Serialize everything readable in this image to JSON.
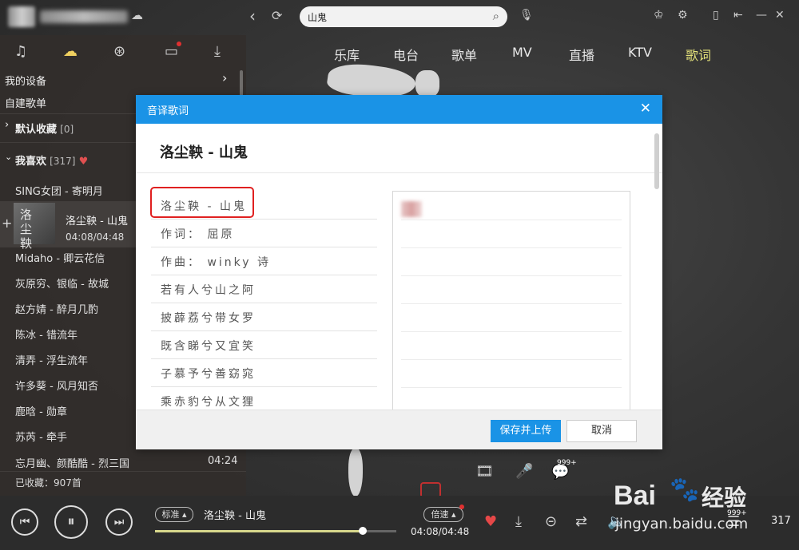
{
  "search": {
    "value": "山鬼"
  },
  "sidebar": {
    "my_devices": "我的设备",
    "custom_playlists": "自建歌单",
    "default_fav_label": "默认收藏",
    "default_fav_count": "[0]",
    "my_likes_label": "我喜欢",
    "my_likes_count": "[317]",
    "songs": [
      "SING女团 - 寄明月",
      "Midaho - 卿云花信",
      "灰原穷、银临 - 故城",
      "赵方婧 - 醉月几酌",
      "陈冰 - 错流年",
      "清弄 - 浮生流年",
      "许多葵 - 风月知否",
      "鹿晗 - 勋章",
      "苏芮 - 牵手",
      "忘月幽、颜酷酷 - 烈三国"
    ],
    "last_song_time": "04:24",
    "now_playing": {
      "title": "洛尘鞅 - 山鬼",
      "time": "04:08/04:48",
      "cover_text": "洛\n尘\n鞅"
    },
    "collected": "已收藏：907首"
  },
  "topnav": [
    "乐库",
    "电台",
    "歌单",
    "MV",
    "直播",
    "KTV",
    "歌词"
  ],
  "dialog": {
    "title": "音译歌词",
    "song": "洛尘鞅 - 山鬼",
    "lyrics": [
      "洛尘鞅 - 山鬼",
      "作词： 屈原",
      "作曲： winky 诗",
      "若有人兮山之阿",
      "披薜荔兮带女罗",
      "既含睇兮又宜笑",
      "子慕予兮善窈窕",
      "乘赤豹兮从文狸"
    ],
    "save_label": "保存并上传",
    "cancel_label": "取消"
  },
  "mid": {
    "badge": "999+"
  },
  "player": {
    "quality": "标准",
    "title": "洛尘鞅 - 山鬼",
    "speed": "倍速",
    "time": "04:08/04:48",
    "progress": 0.86,
    "badge": "999+",
    "count": "317"
  },
  "watermark": {
    "brand": "Bai",
    "brand2": "经验",
    "url": "jingyan.baidu.com"
  },
  "colors": {
    "accent": "#1a93e6",
    "highlight": "#e02020",
    "nav_active": "#e2e07a"
  }
}
